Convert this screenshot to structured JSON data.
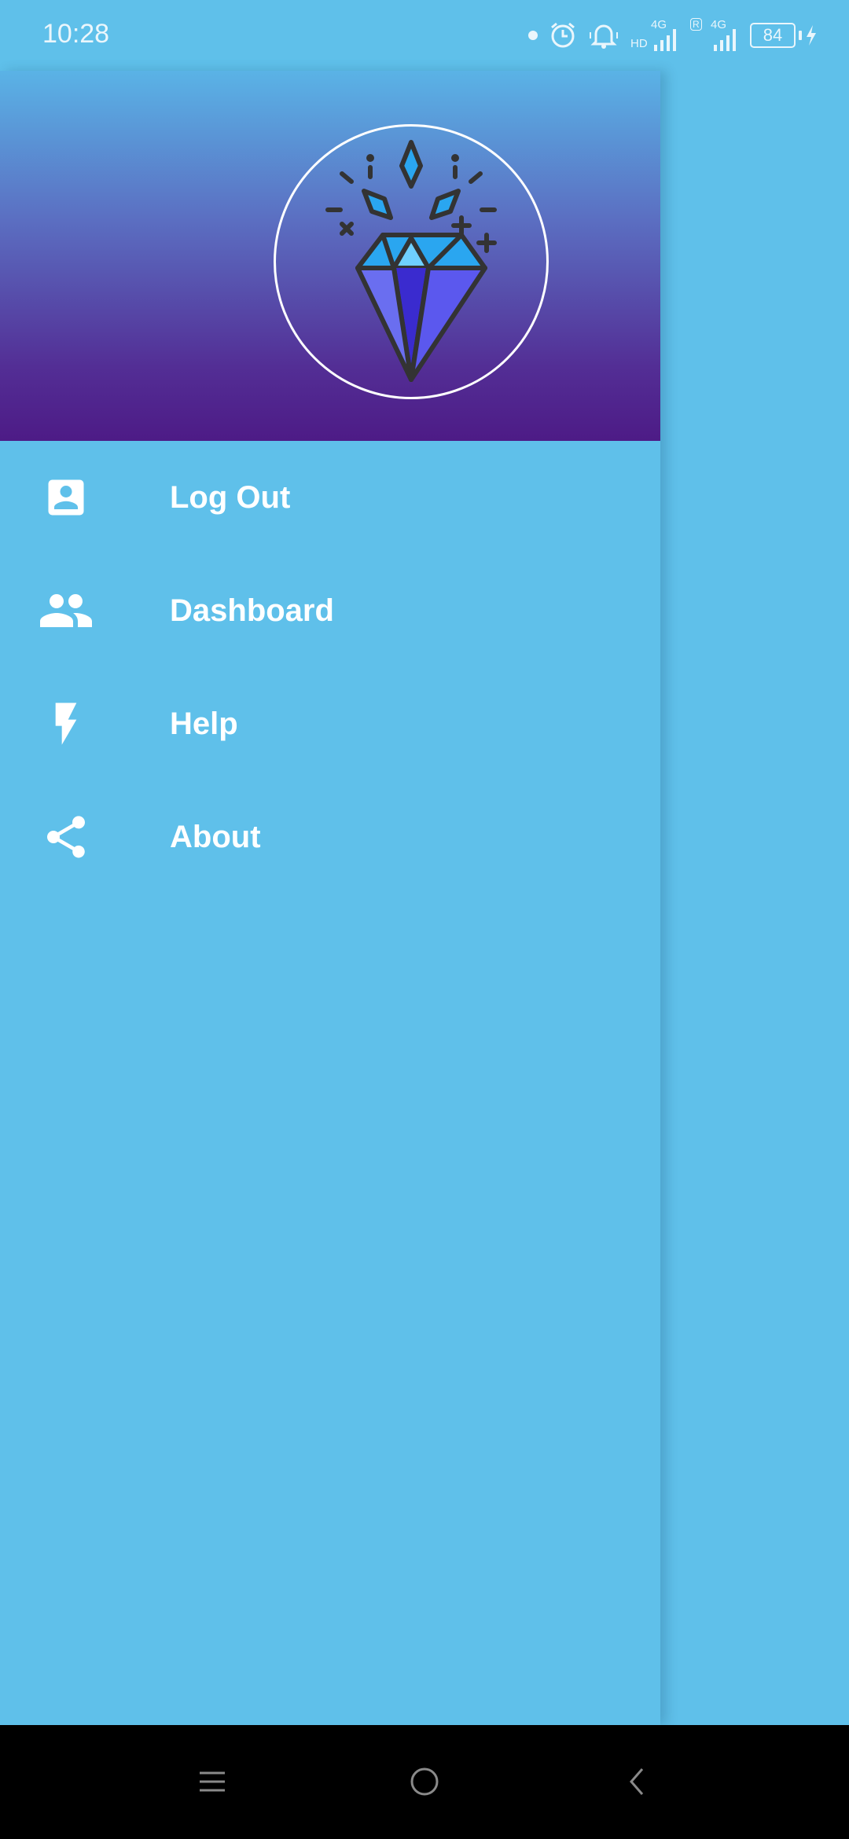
{
  "status_bar": {
    "time": "10:28",
    "battery": "84",
    "net1_top": "4G",
    "net1_bottom": "HD",
    "net2_top": "4G",
    "net2_badge": "R"
  },
  "drawer": {
    "menu": [
      {
        "label": "Log Out",
        "icon": "account-box-icon"
      },
      {
        "label": "Dashboard",
        "icon": "people-icon"
      },
      {
        "label": "Help",
        "icon": "flash-icon"
      },
      {
        "label": "About",
        "icon": "share-icon"
      }
    ]
  },
  "colors": {
    "background": "#5fc0ea",
    "header_top": "#5ab3e6",
    "header_bottom": "#4d1b86"
  }
}
